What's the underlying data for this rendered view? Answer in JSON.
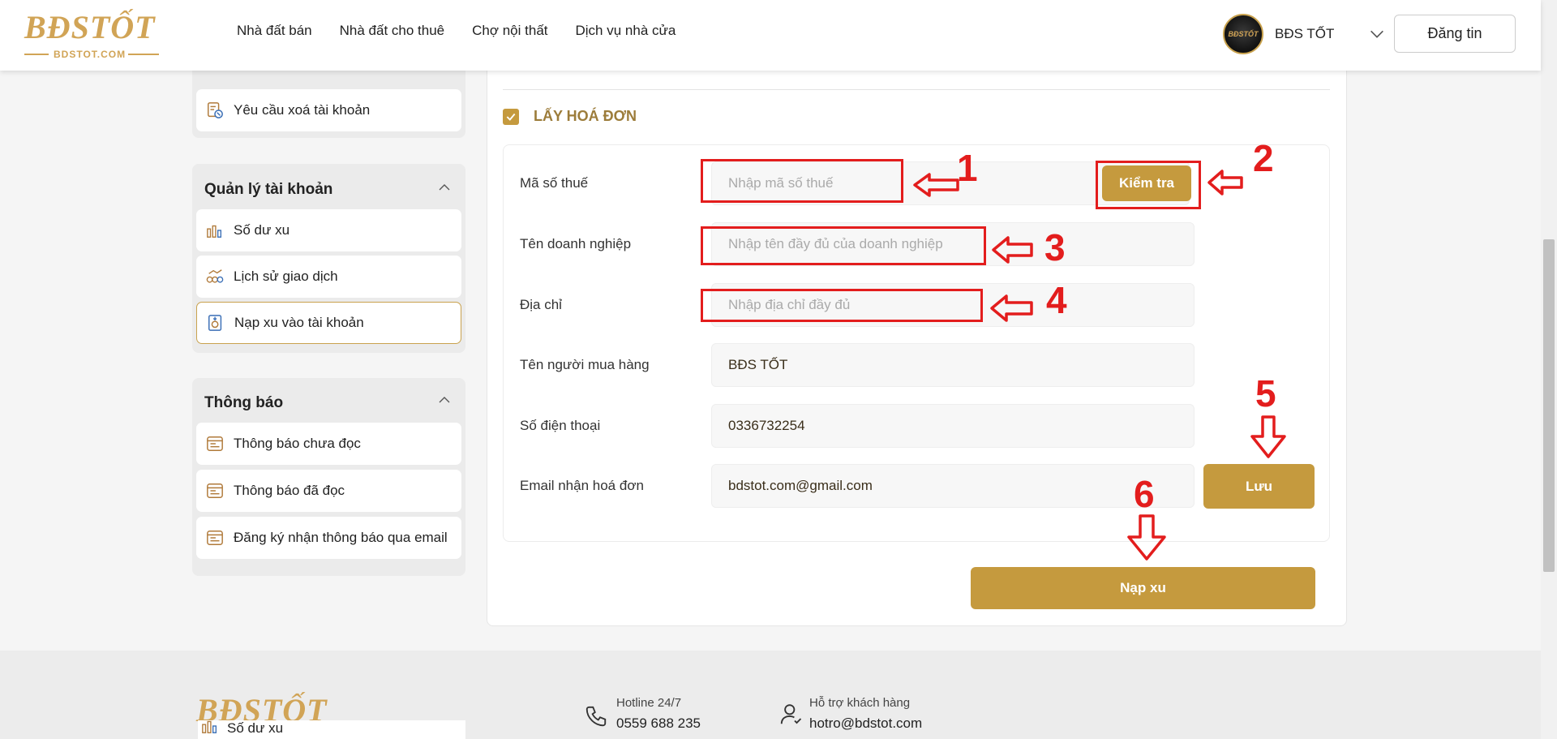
{
  "brand": {
    "logo_text": "BĐSTỐT",
    "logo_sub": "BDSTOT.COM",
    "avatar_text": "BĐSTỐT"
  },
  "nav": {
    "items": [
      "Nhà đất bán",
      "Nhà đất cho thuê",
      "Chợ nội thất",
      "Dịch vụ nhà cửa"
    ]
  },
  "user": {
    "name": "BĐS TỐT",
    "post_label": "Đăng tin"
  },
  "sidebar": {
    "top_item": "Yêu cầu xoá tài khoản",
    "account_section": {
      "title": "Quản lý tài khoản",
      "items": [
        "Số dư xu",
        "Lịch sử giao dịch",
        "Nạp xu vào tài khoản"
      ]
    },
    "notify_section": {
      "title": "Thông báo",
      "items": [
        "Thông báo chưa đọc",
        "Thông báo đã đọc",
        "Đăng ký nhận thông báo qua email"
      ]
    }
  },
  "invoice": {
    "title": "LẤY HOÁ ĐƠN",
    "checked": true,
    "fields": {
      "tax_code": {
        "label": "Mã số thuế",
        "placeholder": "Nhập mã số thuế",
        "value": ""
      },
      "company": {
        "label": "Tên doanh nghiệp",
        "placeholder": "Nhập tên đầy đủ của doanh nghiệp",
        "value": ""
      },
      "address": {
        "label": "Địa chỉ",
        "placeholder": "Nhập địa chỉ đầy đủ",
        "value": ""
      },
      "buyer": {
        "label": "Tên người mua hàng",
        "placeholder": "",
        "value": "BĐS TỐT"
      },
      "phone": {
        "label": "Số điện thoại",
        "placeholder": "",
        "value": "0336732254"
      },
      "email": {
        "label": "Email nhận hoá đơn",
        "placeholder": "",
        "value": "bdstot.com@gmail.com"
      }
    },
    "check_label": "Kiểm tra",
    "save_label": "Lưu",
    "topup_label": "Nạp xu"
  },
  "annotations": [
    "1",
    "2",
    "3",
    "4",
    "5",
    "6"
  ],
  "footer": {
    "logo_text": "BĐSTỐT",
    "hotline_label": "Hotline 24/7",
    "hotline_value": "0559 688 235",
    "support_label": "Hỗ trợ khách hàng",
    "support_value": "hotro@bdstot.com",
    "overlay_item": "Số dư xu"
  },
  "colors": {
    "gold": "#c59a3e",
    "annotation_red": "#e31d1d"
  }
}
